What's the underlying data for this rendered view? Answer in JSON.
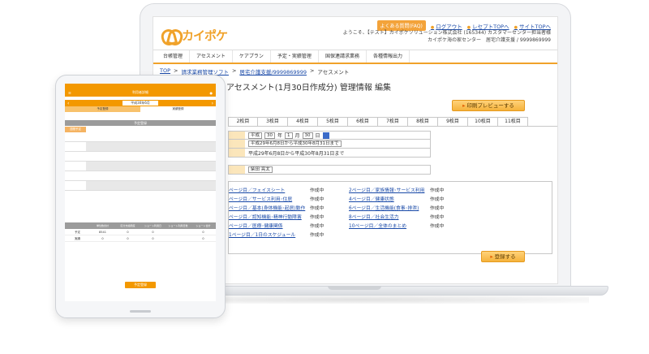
{
  "brand": {
    "logo_text": "カイポケ",
    "accent": "#f0a22a"
  },
  "top_links": {
    "faq": "よくある質問(FAQ)",
    "logout": "ログアウト",
    "receipt_top": "レセプトTOPへ",
    "site_top": "サイトTOPへ"
  },
  "welcome": {
    "line1": "ようこそ、【テスト】カイポケソリューション株式会社 (165344) カスタマーセンター担当者様",
    "line2": "カイポケ海の家センター　居宅介護支援 / 9999869999"
  },
  "nav": [
    "台帳管理",
    "アセスメント",
    "ケアプラン",
    "予定・実績管理",
    "国保連請求業務",
    "各種情報出力"
  ],
  "breadcrumb": {
    "top": "TOP",
    "b1": "請求業務管理ソフト",
    "b2": "居宅介護支援/9999869999",
    "current": "アセスメント"
  },
  "page_title": "アセスメント(1月30日作成分) 管理情報 編集",
  "print_button": "印刷プレビューする",
  "tabs": [
    "2枚目",
    "3枚目",
    "4枚目",
    "5枚目",
    "6枚目",
    "7枚目",
    "8枚目",
    "9枚目",
    "10枚目",
    "11枚目"
  ],
  "form": {
    "era": "平成",
    "year": "30",
    "year_unit": "年",
    "month": "1",
    "month_unit": "月",
    "day": "30",
    "day_unit": "日",
    "period_select": "平成29年6月8日から平成30年8月31日まで",
    "period_text": "平成29年6月8日から平成30年8月31日まで",
    "staff": "柴田 亮太"
  },
  "pages": [
    {
      "left": "ページ目／フェイスシート",
      "left_status": "作成中",
      "right": "2ページ目／家族情報･サービス利用",
      "right_status": "作成中"
    },
    {
      "left": "ページ目／サービス利用･住居",
      "left_status": "作成中",
      "right": "4ページ目／健康状態",
      "right_status": "作成中"
    },
    {
      "left": "ページ目／基本(身体機能･起居)動作",
      "left_status": "作成中",
      "right": "6ページ目／生活機能(食事･排泄)",
      "right_status": "作成中"
    },
    {
      "left": "ページ目／認知機能･精神行動障害",
      "left_status": "作成中",
      "right": "8ページ目／社会生活力",
      "right_status": "作成中"
    },
    {
      "left": "ページ目／医療･健康関係",
      "left_status": "作成中",
      "right": "10ページ目／全体のまとめ",
      "right_status": "作成中"
    },
    {
      "left": "1ページ目／1日のスケジュール",
      "left_status": "作成中",
      "right": "",
      "right_status": ""
    }
  ],
  "register_button": "登録する",
  "tablet": {
    "title": "利用者詳細",
    "date": "平成30年6月",
    "subtab_left": "予定登録",
    "subtab_right": "実績登録",
    "section": "予定登録",
    "col_head": "週間予定",
    "sum_heads": [
      "",
      "単位数合計",
      "区分支給限度",
      "ショート利用日",
      "ショート利用日数",
      "ショート合計"
    ],
    "sum_rows": [
      [
        "予定",
        "8541",
        "0",
        "0",
        "",
        "0"
      ],
      [
        "実績",
        "0",
        "0",
        "0",
        "",
        "0"
      ]
    ],
    "button": "予定登録"
  }
}
